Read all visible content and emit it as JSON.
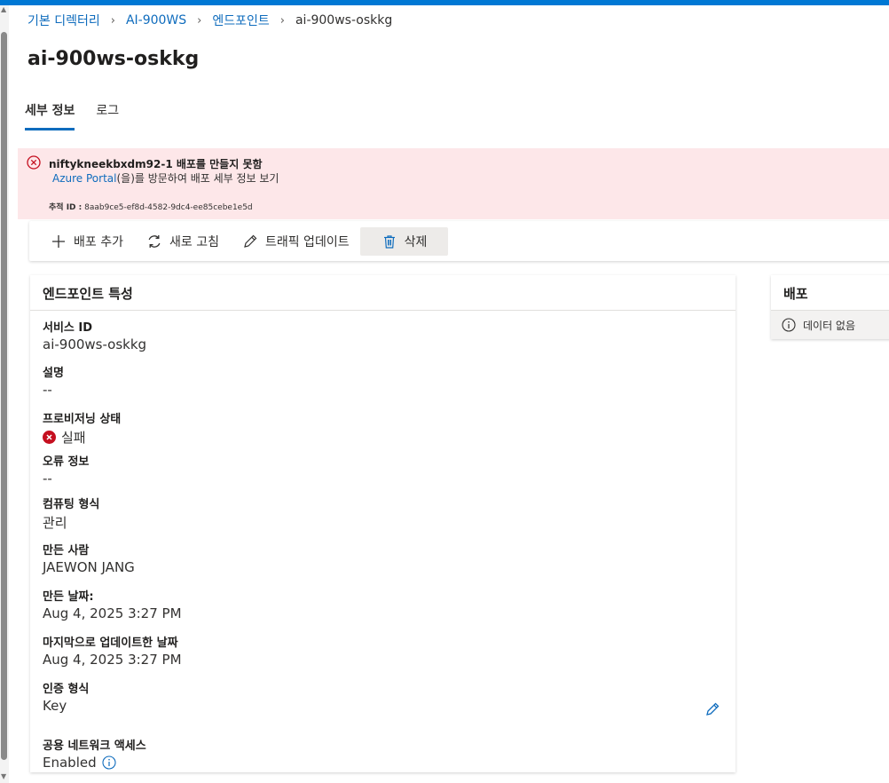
{
  "breadcrumb": {
    "items": [
      "기본 디렉터리",
      "AI-900WS",
      "엔드포인트"
    ],
    "current": "ai-900ws-oskkg"
  },
  "page": {
    "title": "ai-900ws-oskkg"
  },
  "tabs": [
    {
      "label": "세부 정보",
      "active": true
    },
    {
      "label": "로그",
      "active": false
    }
  ],
  "error": {
    "title": "niftykneekbxdm92-1 배포를 만들지 못함",
    "link_text": "Azure Portal",
    "line2_rest": "(을)를 방문하여 배포 세부 정보 보기",
    "trace_label": "추적 ID :",
    "trace_id": "8aab9ce5-ef8d-4582-9dc4-ee85cebe1e5d"
  },
  "commands": {
    "add": "배포 추가",
    "refresh": "새로 고침",
    "update_traffic": "트래픽 업데이트",
    "delete": "삭제"
  },
  "properties": {
    "header": "엔드포인트 특성",
    "service_id": {
      "label": "서비스 ID",
      "value": "ai-900ws-oskkg"
    },
    "description": {
      "label": "설명",
      "value": "--"
    },
    "provisioning": {
      "label": "프로비저닝 상태",
      "value": "실패"
    },
    "error_info": {
      "label": "오류 정보",
      "value": "--"
    },
    "compute_type": {
      "label": "컴퓨팅 형식",
      "value": "관리"
    },
    "created_by": {
      "label": "만든 사람",
      "value": "JAEWON JANG"
    },
    "created_on": {
      "label": "만든 날짜:",
      "value": "Aug 4, 2025 3:27 PM"
    },
    "updated_on": {
      "label": "마지막으로 업데이트한 날짜",
      "value": "Aug 4, 2025 3:27 PM"
    },
    "auth_type": {
      "label": "인증 형식",
      "value": "Key"
    },
    "public_access": {
      "label": "공용 네트워크 액세스",
      "value": "Enabled"
    }
  },
  "deployments": {
    "header": "배포",
    "empty": "데이터 없음"
  },
  "colors": {
    "accent": "#0f6cbd",
    "error_bg": "#fde7e9",
    "error_red": "#c50f1f"
  }
}
